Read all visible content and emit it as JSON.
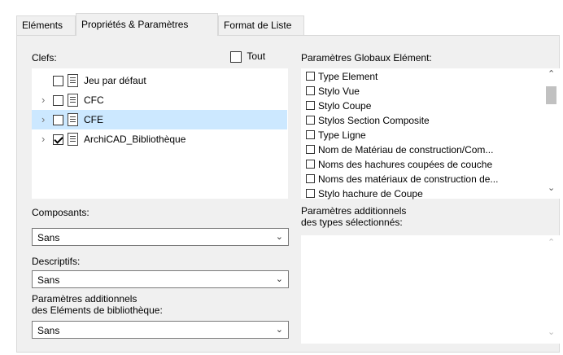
{
  "tabs": [
    {
      "label": "Eléments"
    },
    {
      "label": "Propriétés & Paramètres"
    },
    {
      "label": "Format de Liste"
    }
  ],
  "clefs": {
    "label": "Clefs:",
    "tout_label": "Tout",
    "items": [
      {
        "label": "Jeu par défaut",
        "checked": false,
        "expandable": false,
        "selected": false
      },
      {
        "label": "CFC",
        "checked": false,
        "expandable": true,
        "selected": false
      },
      {
        "label": "CFE",
        "checked": false,
        "expandable": true,
        "selected": true
      },
      {
        "label": "ArchiCAD_Bibliothèque",
        "checked": true,
        "expandable": true,
        "selected": false
      }
    ]
  },
  "global_params": {
    "label": "Paramètres Globaux Elément:",
    "items": [
      "Type Element",
      "Stylo Vue",
      "Stylo Coupe",
      "Stylos Section Composite",
      "Type Ligne",
      "Nom de Matériau de construction/Com...",
      "Noms des hachures coupées de couche",
      "Noms des matériaux de construction de...",
      "Stylo hachure de Coupe"
    ]
  },
  "composants": {
    "label": "Composants:",
    "value": "Sans"
  },
  "descriptifs": {
    "label": "Descriptifs:",
    "value": "Sans"
  },
  "lib_params": {
    "label_line1": "Paramètres additionnels",
    "label_line2": "des Eléments de bibliothèque:",
    "value": "Sans"
  },
  "types_params": {
    "label_line1": "Paramètres additionnels",
    "label_line2": "des types sélectionnés:"
  },
  "icons": {
    "expand": "chevron-right-icon",
    "dropdown": "chevron-down-icon",
    "scroll_up": "chevron-up-icon",
    "scroll_down": "chevron-down-icon"
  },
  "colors": {
    "selection": "#cce8ff",
    "panel": "#f0f0f0"
  }
}
